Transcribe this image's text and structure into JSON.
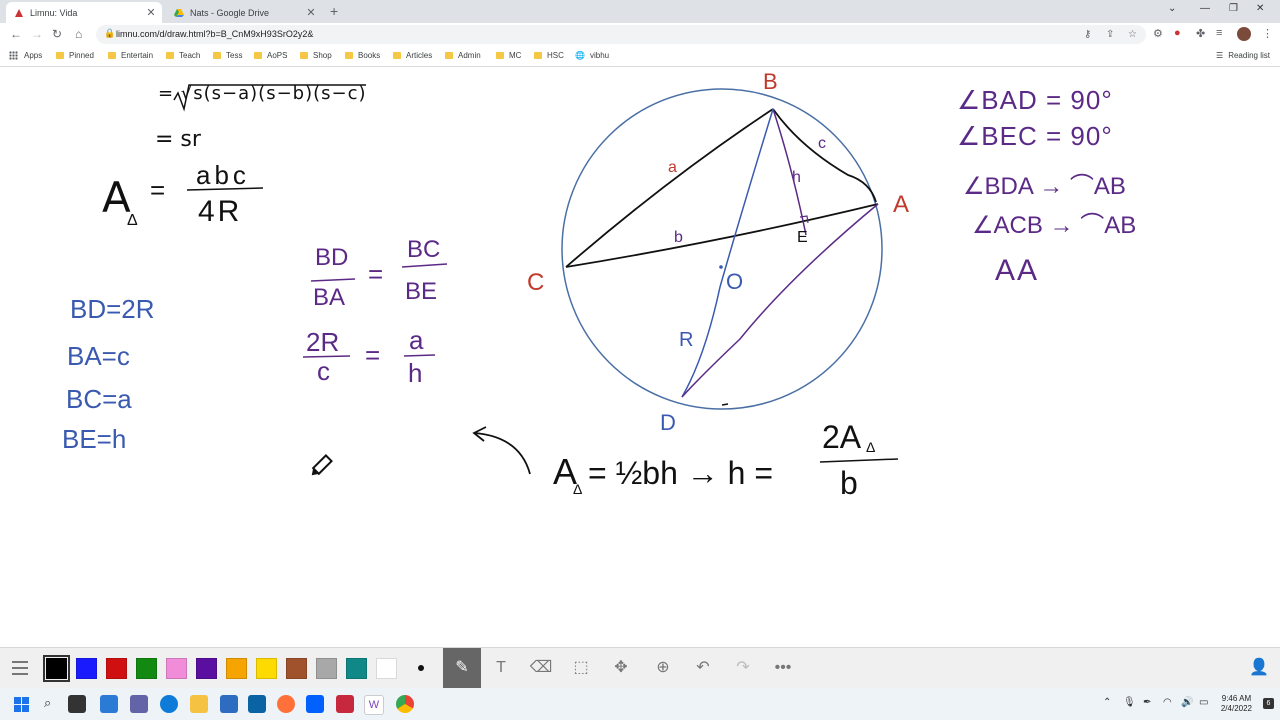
{
  "browser": {
    "tabs": [
      {
        "title": "Limnu: Vida",
        "active": true
      },
      {
        "title": "Nats - Google Drive",
        "active": false
      }
    ],
    "url": "limnu.com/d/draw.html?b=B_CnM9xH93SrO2y2&",
    "bookmarks": [
      "Apps",
      "Pinned",
      "Entertain",
      "Teach",
      "Tess",
      "AoPS",
      "Shop",
      "Books",
      "Articles",
      "Admin",
      "MC",
      "HSC",
      "vibhu"
    ],
    "reading_list": "Reading list"
  },
  "board": {
    "heron_line": "= √s(s−a)(s−b)(s−c)",
    "sr_line": "= sr",
    "area_lhs": "A",
    "area_sub": "Δ",
    "area_eq": "=",
    "area_num": "abc",
    "area_den": "4R",
    "left_list": [
      "BD=2R",
      "BA=c",
      "BC=a",
      "BE=h"
    ],
    "ratio1": {
      "num_l": "BD",
      "den_l": "BA",
      "eq": "=",
      "num_r": "BC",
      "den_r": "BE"
    },
    "ratio2": {
      "num_l": "2R",
      "den_l": "c",
      "eq": "=",
      "num_r": "a",
      "den_r": "h"
    },
    "points": {
      "B": "B",
      "A": "A",
      "C": "C",
      "D": "D",
      "O": "O",
      "E": "E"
    },
    "segment_labels": {
      "a": "a",
      "b": "b",
      "c": "c",
      "h": "h",
      "R": "R"
    },
    "angles": [
      "∠BAD = 90°",
      "∠BEC = 90°",
      "∠BDA → ⌒AB",
      "∠ACB → ⌒AB"
    ],
    "similarity": "AA",
    "formula": {
      "lhs": "A",
      "sub": "Δ",
      "mid": "= ½bh → h =",
      "num": "2A",
      "num_sub": "Δ",
      "den": "b"
    }
  },
  "drawbar": {
    "colors": [
      "#000000",
      "#1a1aff",
      "#d01010",
      "#128a12",
      "#f08cd8",
      "#5a0fa0",
      "#f5a400",
      "#fedb00",
      "#a0522d",
      "#a8a8a8",
      "#118888",
      "#ffffff"
    ],
    "selected_color": "#000000"
  },
  "taskbar": {
    "time": "9:46 AM",
    "date": "2/4/2022",
    "notification_count": "6"
  },
  "ink_colors": {
    "black": "#111111",
    "red": "#c0392b",
    "blue": "#3a5ab0",
    "purple": "#5b2a86",
    "circle": "#4a6fa5"
  }
}
